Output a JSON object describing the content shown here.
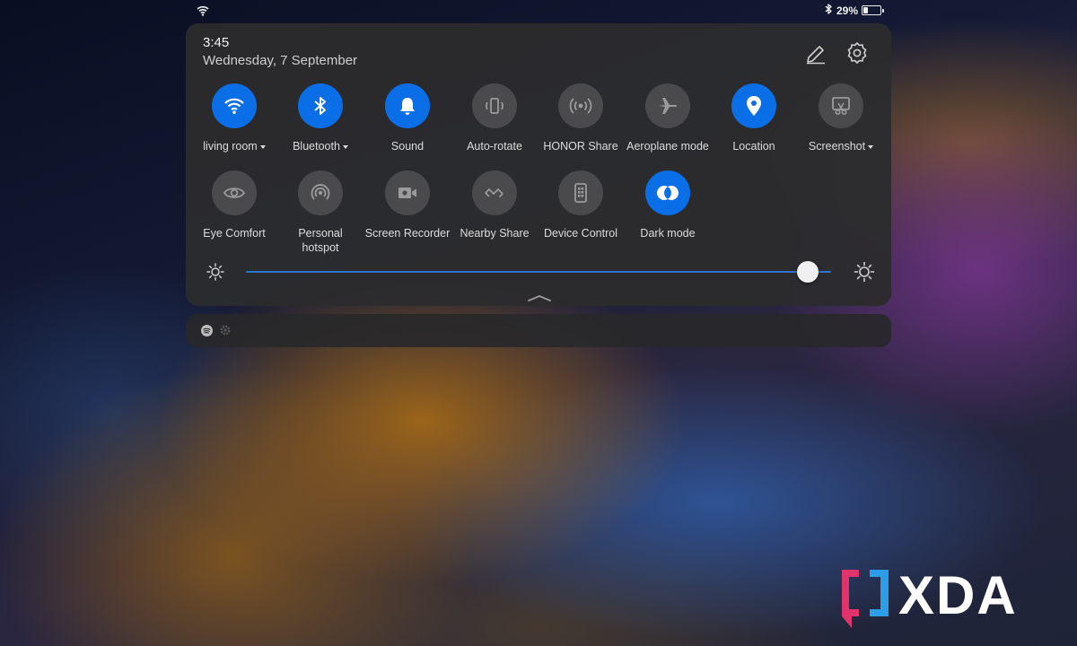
{
  "status_bar": {
    "battery_percent": "29%",
    "battery_level": 0.29,
    "icons": [
      "wifi-icon",
      "bluetooth-icon",
      "battery-icon"
    ]
  },
  "header": {
    "time": "3:45",
    "date": "Wednesday, 7 September"
  },
  "tiles": [
    {
      "label": "living room",
      "icon": "wifi-icon",
      "active": true,
      "dropdown": true
    },
    {
      "label": "Bluetooth",
      "icon": "bluetooth-icon",
      "active": true,
      "dropdown": true
    },
    {
      "label": "Sound",
      "icon": "bell-icon",
      "active": true,
      "dropdown": false
    },
    {
      "label": "Auto-rotate",
      "icon": "auto-rotate-icon",
      "active": false,
      "dropdown": false
    },
    {
      "label": "HONOR Share",
      "icon": "honor-share-icon",
      "active": false,
      "dropdown": false
    },
    {
      "label": "Aeroplane mode",
      "icon": "airplane-icon",
      "active": false,
      "dropdown": false
    },
    {
      "label": "Location",
      "icon": "location-pin-icon",
      "active": true,
      "dropdown": false
    },
    {
      "label": "Screenshot",
      "icon": "screenshot-icon",
      "active": false,
      "dropdown": true
    },
    {
      "label": "Eye Comfort",
      "icon": "eye-icon",
      "active": false,
      "dropdown": false
    },
    {
      "label": "Personal hotspot",
      "icon": "hotspot-icon",
      "active": false,
      "dropdown": false
    },
    {
      "label": "Screen Recorder",
      "icon": "video-camera-icon",
      "active": false,
      "dropdown": false
    },
    {
      "label": "Nearby Share",
      "icon": "nearby-share-icon",
      "active": false,
      "dropdown": false
    },
    {
      "label": "Device Control",
      "icon": "device-control-icon",
      "active": false,
      "dropdown": false
    },
    {
      "label": "Dark mode",
      "icon": "dark-mode-icon",
      "active": true,
      "dropdown": false
    }
  ],
  "brightness": {
    "level": 0.96
  },
  "notification": {
    "icons": [
      "spotify-icon",
      "gear-icon"
    ]
  },
  "watermark": {
    "text": "XDA"
  },
  "colors": {
    "accent": "#0a6ee6",
    "tile_inactive": "#4a4a4c",
    "panel": "#2c2c2e",
    "watermark_pink": "#e0336b",
    "watermark_blue": "#2c9ee8"
  }
}
